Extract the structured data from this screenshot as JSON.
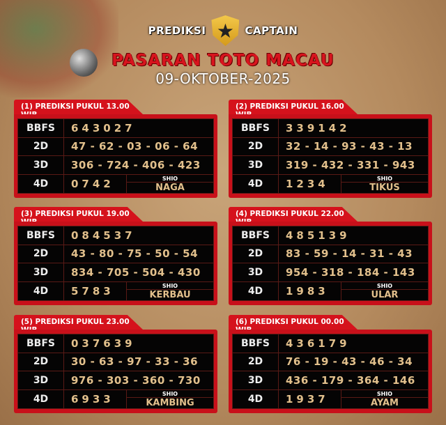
{
  "header": {
    "brand_left": "PREDIKSI",
    "brand_right": "CAPTAIN",
    "title": "PASARAN TOTO MACAU",
    "date": "09-OKTOBER-2025"
  },
  "labels": {
    "bbfs": "BBFS",
    "d2": "2D",
    "d3": "3D",
    "d4": "4D",
    "shio": "SHIO"
  },
  "colors": {
    "accent_red": "#d5121c",
    "gold_text": "#e2c08c",
    "panel": "#050404"
  },
  "cards": [
    {
      "title": "(1) PREDIKSI PUKUL 13.00 WIB",
      "bbfs": "643027",
      "d2": "47 - 62 - 03 - 06 - 64",
      "d3": "306 - 724 - 406 - 423",
      "d4": "0742",
      "shio": "NAGA"
    },
    {
      "title": "(2) PREDIKSI PUKUL 16.00 WIB",
      "bbfs": "339142",
      "d2": "32 - 14 - 93 - 43 - 13",
      "d3": "319 - 432 - 331 - 943",
      "d4": "1234",
      "shio": "TIKUS"
    },
    {
      "title": "(3) PREDIKSI PUKUL 19.00 WIB",
      "bbfs": "084537",
      "d2": "43 - 80 - 75 - 50 - 54",
      "d3": "834 - 705 - 504 - 430",
      "d4": "5783",
      "shio": "KERBAU"
    },
    {
      "title": "(4) PREDIKSI PUKUL 22.00 WIB",
      "bbfs": "485139",
      "d2": "83 - 59 - 14 - 31 - 43",
      "d3": "954 - 318 - 184 - 143",
      "d4": "1983",
      "shio": "ULAR"
    },
    {
      "title": "(5) PREDIKSI PUKUL 23.00 WIB",
      "bbfs": "037639",
      "d2": "30 - 63 - 97 - 33 - 36",
      "d3": "976 - 303 - 360 - 730",
      "d4": "6933",
      "shio": "KAMBING"
    },
    {
      "title": "(6) PREDIKSI PUKUL 00.00 WIB",
      "bbfs": "436179",
      "d2": "76 - 19 - 43 - 46 - 34",
      "d3": "436 - 179 - 364 - 146",
      "d4": "1937",
      "shio": "AYAM"
    }
  ]
}
